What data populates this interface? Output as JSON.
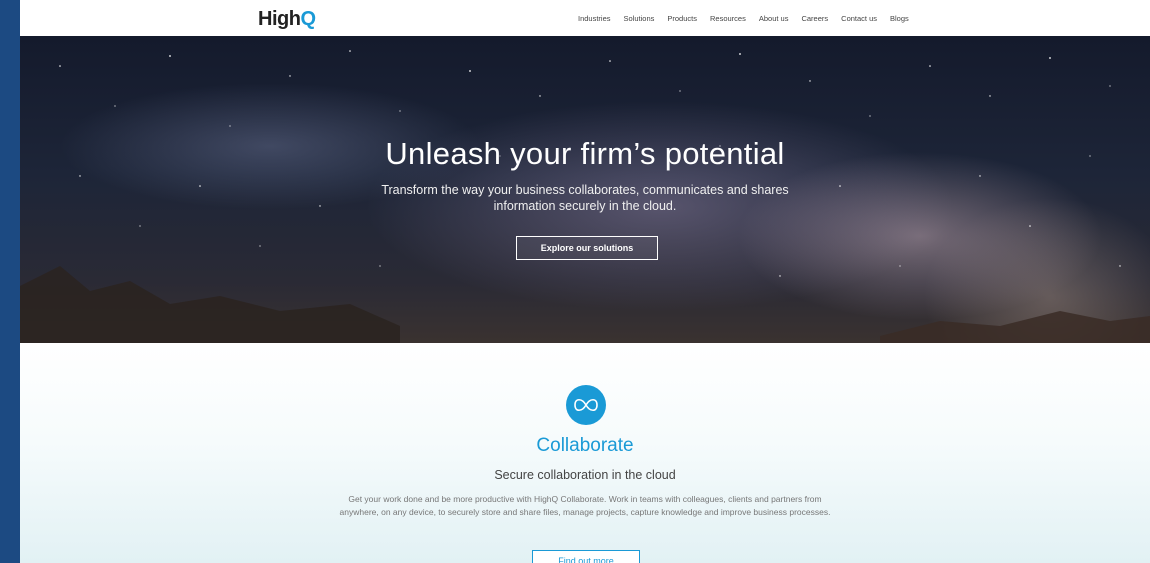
{
  "header": {
    "logo_text": "High",
    "logo_q": "Q",
    "nav": [
      "Industries",
      "Solutions",
      "Products",
      "Resources",
      "About us",
      "Careers",
      "Contact us",
      "Blogs"
    ]
  },
  "hero": {
    "title": "Unleash your firm’s potential",
    "subtitle": "Transform the way your business collaborates, communicates and shares information securely in the cloud.",
    "button_label": "Explore our solutions"
  },
  "collaborate": {
    "icon": "infinity-icon",
    "title": "Collaborate",
    "subtitle": "Secure collaboration in the cloud",
    "body": "Get your work done and be more productive with HighQ Collaborate. Work in teams with colleagues, clients and partners from anywhere, on any device, to securely store and share files, manage projects, capture knowledge and improve business processes.",
    "button_label": "Find out more"
  },
  "colors": {
    "accent": "#1a9ad6",
    "frame": "#1c4a82"
  }
}
